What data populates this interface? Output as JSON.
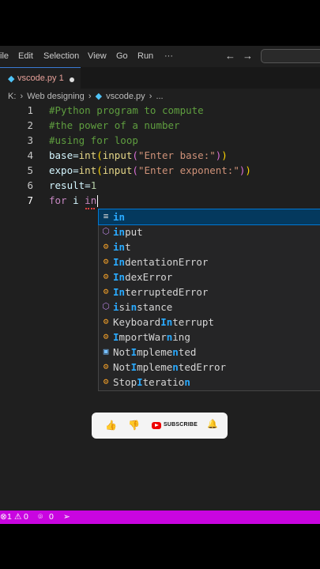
{
  "menubar": {
    "items": [
      "ile",
      "Edit",
      "Selection",
      "View",
      "Go",
      "Run",
      "···"
    ],
    "back_arrow": "←",
    "forward_arrow": "→"
  },
  "tab": {
    "label": "vscode.py 1",
    "icon": "python-file-icon"
  },
  "breadcrumb": [
    "K:",
    "›",
    "Web designing",
    "›",
    "vscode.py",
    "›",
    "..."
  ],
  "code": {
    "line_numbers": [
      "1",
      "2",
      "3",
      "4",
      "5",
      "6",
      "7"
    ],
    "lines": [
      "#Python program to compute",
      "#the power of a number",
      "#using for loop",
      "base=int(input(\"Enter base:\"))",
      "expo=int(input(\"Enter exponent:\"))",
      "result=1",
      "for i in"
    ]
  },
  "suggestions": [
    {
      "label": "in",
      "kind": "keyword",
      "icon": "keyword-icon"
    },
    {
      "label": "input",
      "kind": "function",
      "icon": "method-icon"
    },
    {
      "label": "int",
      "kind": "class",
      "icon": "class-icon"
    },
    {
      "label": "IndentationError",
      "kind": "class",
      "icon": "class-icon"
    },
    {
      "label": "IndexError",
      "kind": "class",
      "icon": "class-icon"
    },
    {
      "label": "InterruptedError",
      "kind": "class",
      "icon": "class-icon"
    },
    {
      "label": "isinstance",
      "kind": "function",
      "icon": "method-icon"
    },
    {
      "label": "KeyboardInterrupt",
      "kind": "class",
      "icon": "class-icon"
    },
    {
      "label": "ImportWarning",
      "kind": "class",
      "icon": "class-icon"
    },
    {
      "label": "NotImplemented",
      "kind": "constant",
      "icon": "constant-icon"
    },
    {
      "label": "NotImplementedError",
      "kind": "class",
      "icon": "class-icon"
    },
    {
      "label": "StopIteration",
      "kind": "class",
      "icon": "class-icon"
    }
  ],
  "youtube": {
    "subscribe_label": "SUBSCRIBE"
  },
  "statusbar": {
    "errors": "1",
    "warnings": "0",
    "ports": "0"
  },
  "colors": {
    "statusbar": "#c905e0",
    "accent": "#2aaaff"
  }
}
